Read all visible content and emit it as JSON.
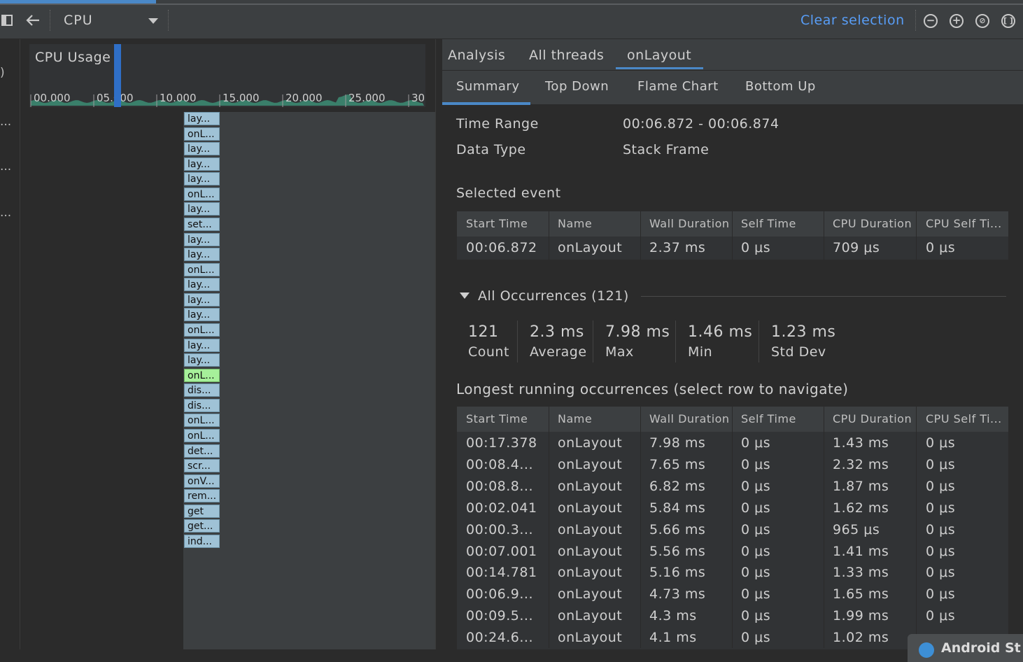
{
  "toolbar": {
    "profiler_select": "CPU",
    "clear_selection": "Clear selection"
  },
  "left_rail": {
    "texts": [
      ")",
      "...",
      "...",
      "..."
    ]
  },
  "cpu_usage": {
    "title": "CPU Usage",
    "ticks": [
      "00.000",
      "05.000",
      "10.000",
      "15.000",
      "20.000",
      "25.000",
      "30"
    ]
  },
  "flame_frames": [
    "lay...",
    "onL...",
    "lay...",
    "lay...",
    "lay...",
    "onL...",
    "lay...",
    "set...",
    "lay...",
    "lay...",
    "onL...",
    "lay...",
    "lay...",
    "lay...",
    "onL...",
    "lay...",
    "lay...",
    "onL...",
    "dis...",
    "dis...",
    "onL...",
    "onL...",
    "det...",
    "scr...",
    "onV...",
    "rem...",
    "get",
    "get...",
    "ind..."
  ],
  "selected_frame_index": 17,
  "tabs1": [
    {
      "label": "Analysis"
    },
    {
      "label": "All threads"
    },
    {
      "label": "onLayout"
    }
  ],
  "tabs2": [
    {
      "label": "Summary"
    },
    {
      "label": "Top Down"
    },
    {
      "label": "Flame Chart"
    },
    {
      "label": "Bottom Up"
    }
  ],
  "summary": {
    "time_range_label": "Time Range",
    "time_range_value": "00:06.872 - 00:06.874",
    "data_type_label": "Data Type",
    "data_type_value": "Stack Frame",
    "selected_event_title": "Selected event"
  },
  "table_columns": [
    "Start Time",
    "Name",
    "Wall Duration",
    "Self Time",
    "CPU Duration",
    "CPU Self Ti..."
  ],
  "selected_event_row": [
    "00:06.872",
    "onLayout",
    "2.37 ms",
    "0 μs",
    "709 μs",
    "0 μs"
  ],
  "occurrences": {
    "header": "All Occurrences (121)",
    "stats": [
      {
        "value": "121",
        "label": "Count"
      },
      {
        "value": "2.3 ms",
        "label": "Average"
      },
      {
        "value": "7.98 ms",
        "label": "Max"
      },
      {
        "value": "1.46 ms",
        "label": "Min"
      },
      {
        "value": "1.23 ms",
        "label": "Std Dev"
      }
    ]
  },
  "longest": {
    "title": "Longest running occurrences (select row to navigate)",
    "rows": [
      [
        "00:17.378",
        "onLayout",
        "7.98 ms",
        "0 μs",
        "1.43 ms",
        "0 μs"
      ],
      [
        "00:08.4...",
        "onLayout",
        "7.65 ms",
        "0 μs",
        "2.32 ms",
        "0 μs"
      ],
      [
        "00:08.8...",
        "onLayout",
        "6.82 ms",
        "0 μs",
        "1.87 ms",
        "0 μs"
      ],
      [
        "00:02.041",
        "onLayout",
        "5.84 ms",
        "0 μs",
        "1.62 ms",
        "0 μs"
      ],
      [
        "00:00.3...",
        "onLayout",
        "5.66 ms",
        "0 μs",
        "965 μs",
        "0 μs"
      ],
      [
        "00:07.001",
        "onLayout",
        "5.56 ms",
        "0 μs",
        "1.41 ms",
        "0 μs"
      ],
      [
        "00:14.781",
        "onLayout",
        "5.16 ms",
        "0 μs",
        "1.33 ms",
        "0 μs"
      ],
      [
        "00:06.9...",
        "onLayout",
        "4.73 ms",
        "0 μs",
        "1.65 ms",
        "0 μs"
      ],
      [
        "00:09.5...",
        "onLayout",
        "4.3 ms",
        "0 μs",
        "1.99 ms",
        "0 μs"
      ],
      [
        "00:24.6...",
        "onLayout",
        "4.1 ms",
        "0 μs",
        "1.02 ms",
        ""
      ]
    ]
  },
  "popup": {
    "text": "Android St"
  },
  "colors": {
    "accent": "#4a88c7",
    "link": "#589df6",
    "frame": "#9fc2d6",
    "frame_selected": "#a6f09a",
    "cpu_graph": "#3a7f6a"
  }
}
